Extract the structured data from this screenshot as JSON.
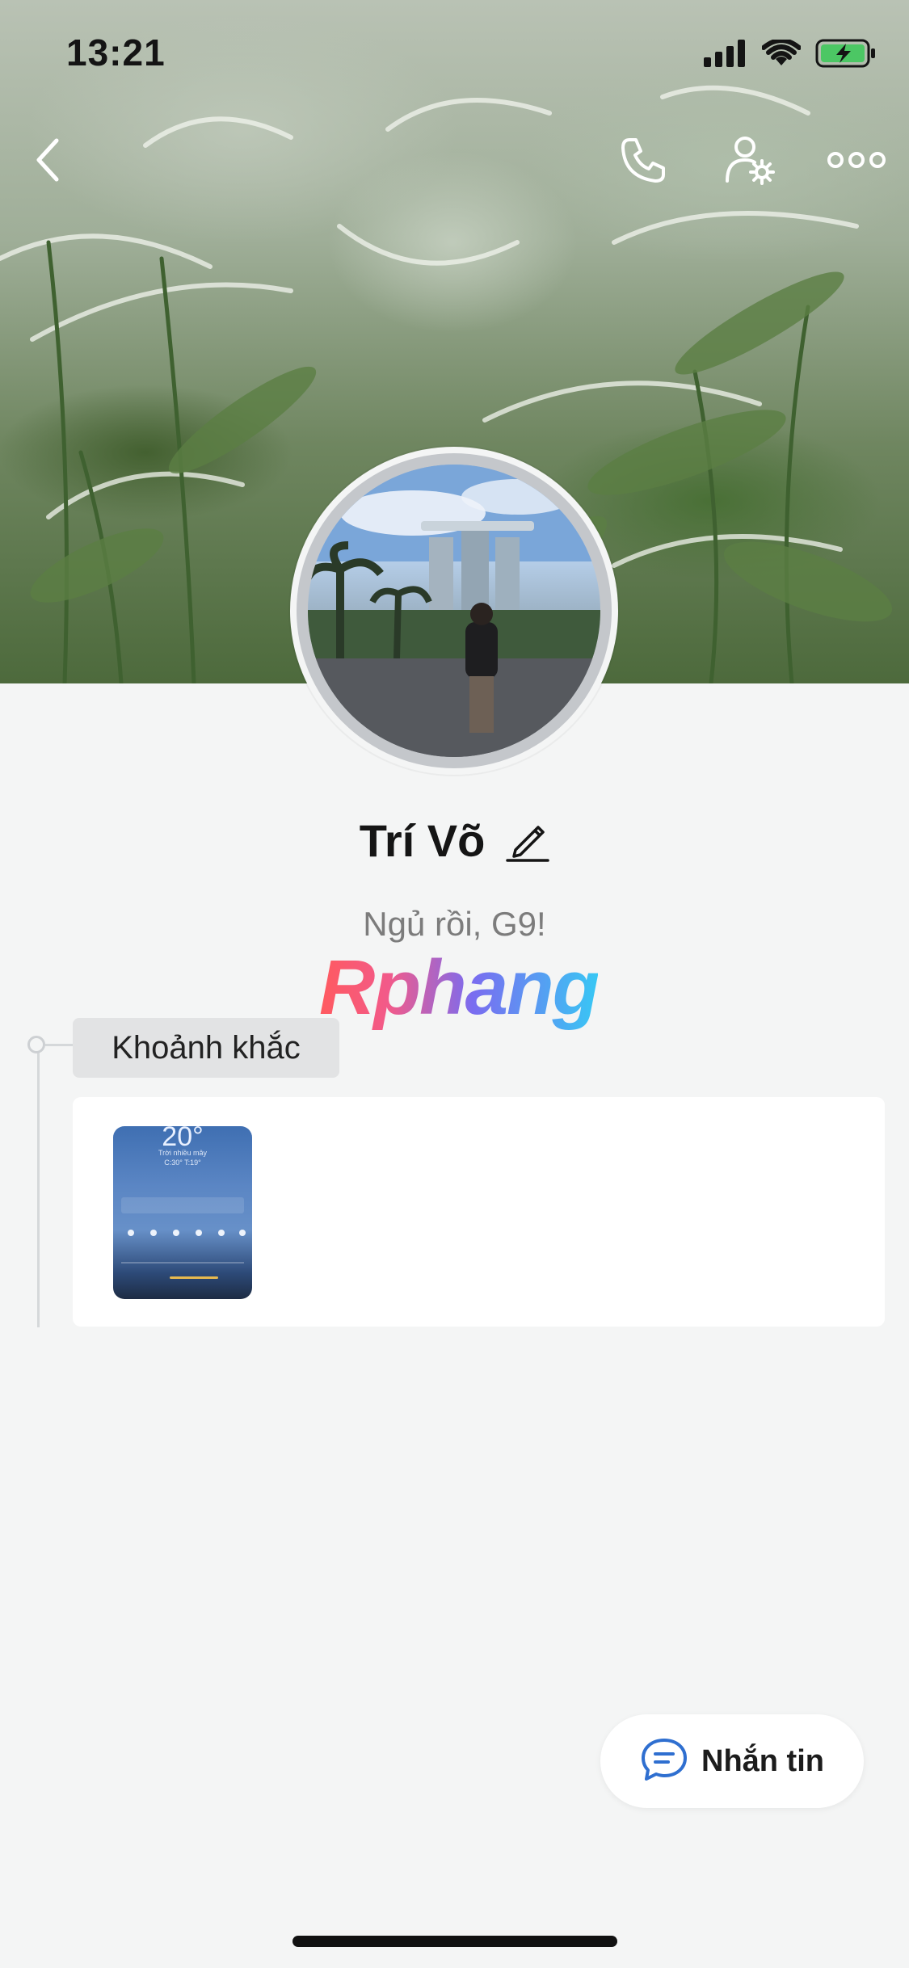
{
  "status_bar": {
    "time": "13:21"
  },
  "profile": {
    "name": "Trí Võ",
    "bio": "Ngủ rồi, G9!"
  },
  "watermark": "Rphang",
  "moments": {
    "label": "Khoảnh khắc"
  },
  "thumbnail": {
    "temperature": "20°",
    "condition": "Trời nhiều mây",
    "range": "C:30° T:19°"
  },
  "message_button": {
    "label": "Nhắn tin"
  },
  "colors": {
    "accent": "#2f6fd0",
    "background": "#f4f5f5",
    "card": "#ffffff"
  },
  "icons": [
    "back-icon",
    "phone-icon",
    "user-settings-icon",
    "more-icon",
    "edit-icon",
    "chat-icon"
  ]
}
